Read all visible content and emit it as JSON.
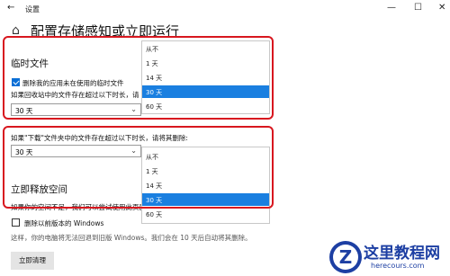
{
  "app": {
    "title": "设置"
  },
  "window_controls": {
    "minimize": "—",
    "maximize": "☐",
    "close": "✕"
  },
  "page": {
    "title": "配置存储感知或立即运行"
  },
  "temp_files": {
    "heading": "临时文件",
    "delete_unused_label": "删除我的应用未在使用的临时文件",
    "delete_unused_checked": true,
    "recycle_bin_label": "如果回收站中的文件存在超过以下时长，请",
    "recycle_bin_value": "30 天",
    "downloads_label": "如果\"下载\"文件夹中的文件存在超过以下时长，请将其删除:",
    "downloads_value": "30 天"
  },
  "dropdown_recycle": {
    "options": [
      "从不",
      "1 天",
      "14 天",
      "30 天",
      "60 天"
    ],
    "selected": "30 天"
  },
  "dropdown_downloads": {
    "options": [
      "从不",
      "1 天",
      "14 天",
      "30 天",
      "60 天"
    ],
    "selected": "30 天"
  },
  "free_space": {
    "heading": "立即释放空间",
    "desc": "如果你的空间不足，我们可以尝试使用此页面",
    "prev_windows_label": "删除以前版本的 Windows",
    "prev_windows_checked": false,
    "note": "这样，你的电脑将无法回退到旧版 Windows。我们会在 10 天后自动将其删除。",
    "clean_button": "立即清理"
  },
  "watermark": {
    "title": "这里教程网",
    "url": "herecours.com",
    "logo_letter": "Z"
  },
  "colors": {
    "accent": "#1a7fe0",
    "highlight": "#d8171f"
  }
}
